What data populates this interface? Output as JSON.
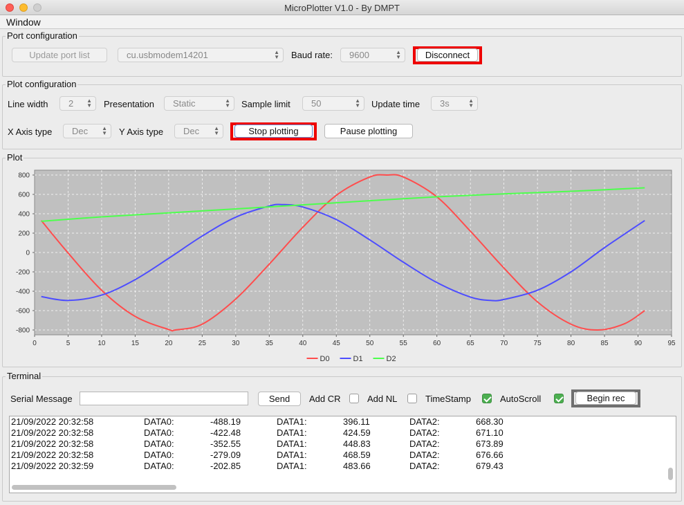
{
  "window": {
    "title": "MicroPlotter V1.0 - By DMPT",
    "menu": [
      "Window"
    ]
  },
  "port_config": {
    "title": "Port configuration",
    "update_port_list_label": "Update port list",
    "port_value": "cu.usbmodem14201",
    "baud_label": "Baud rate:",
    "baud_value": "9600",
    "disconnect_label": "Disconnect"
  },
  "plot_config": {
    "title": "Plot configuration",
    "line_width_label": "Line width",
    "line_width_value": "2",
    "presentation_label": "Presentation",
    "presentation_value": "Static",
    "sample_limit_label": "Sample limit",
    "sample_limit_value": "50",
    "update_time_label": "Update time",
    "update_time_value": "3s",
    "x_axis_label": "X Axis type",
    "x_axis_value": "Dec",
    "y_axis_label": "Y Axis type",
    "y_axis_value": "Dec",
    "stop_plotting_label": "Stop plotting",
    "pause_plotting_label": "Pause plotting"
  },
  "plot": {
    "title": "Plot"
  },
  "chart_data": {
    "type": "line",
    "xlim": [
      0,
      95
    ],
    "ylim": [
      -850,
      850
    ],
    "xticks": [
      0,
      5,
      10,
      15,
      20,
      25,
      30,
      35,
      40,
      45,
      50,
      55,
      60,
      65,
      70,
      75,
      80,
      85,
      90,
      95
    ],
    "yticks": [
      -800,
      -600,
      -400,
      -200,
      0,
      200,
      400,
      600,
      800
    ],
    "grid": true,
    "legend_position": "bottom-center",
    "plot_background": "#c0c0c0",
    "series": [
      {
        "name": "D0",
        "color": "#ff4d4d",
        "x": [
          1,
          5,
          10,
          15,
          20,
          21,
          25,
          30,
          35,
          40,
          45,
          50,
          52.5,
          55,
          60,
          65,
          70,
          75,
          80,
          84,
          88,
          91
        ],
        "y": [
          330,
          -5,
          -390,
          -660,
          -795,
          -800,
          -740,
          -480,
          -120,
          260,
          590,
          780,
          800,
          780,
          575,
          220,
          -160,
          -510,
          -740,
          -800,
          -735,
          -600
        ]
      },
      {
        "name": "D1",
        "color": "#4d4dff",
        "x": [
          1,
          5,
          10,
          15,
          20,
          25,
          30,
          35,
          37,
          40,
          45,
          50,
          55,
          60,
          65,
          68,
          70,
          75,
          80,
          85,
          91
        ],
        "y": [
          -455,
          -495,
          -440,
          -280,
          -60,
          170,
          365,
          480,
          495,
          470,
          340,
          130,
          -100,
          -310,
          -460,
          -495,
          -485,
          -390,
          -200,
          50,
          330
        ]
      },
      {
        "name": "D2",
        "color": "#4dff4d",
        "x": [
          1,
          10,
          20,
          30,
          40,
          50,
          60,
          70,
          80,
          91
        ],
        "y": [
          322,
          368,
          409,
          450,
          492,
          535,
          575,
          605,
          632,
          668
        ]
      }
    ]
  },
  "terminal": {
    "title": "Terminal",
    "serial_label": "Serial Message",
    "serial_value": "",
    "send_label": "Send",
    "add_cr_label": "Add CR",
    "add_cr_checked": false,
    "add_nl_label": "Add NL",
    "add_nl_checked": false,
    "timestamp_label": "TimeStamp",
    "timestamp_checked": true,
    "autoscroll_label": "AutoScroll",
    "autoscroll_checked": true,
    "begin_rec_label": "Begin rec",
    "log": [
      {
        "time": "21/09/2022 20:32:58",
        "k0": "DATA0:",
        "v0": "-488.19",
        "k1": "DATA1:",
        "v1": "396.11",
        "k2": "DATA2:",
        "v2": "668.30"
      },
      {
        "time": "21/09/2022 20:32:58",
        "k0": "DATA0:",
        "v0": "-422.48",
        "k1": "DATA1:",
        "v1": "424.59",
        "k2": "DATA2:",
        "v2": "671.10"
      },
      {
        "time": "21/09/2022 20:32:58",
        "k0": "DATA0:",
        "v0": "-352.55",
        "k1": "DATA1:",
        "v1": "448.83",
        "k2": "DATA2:",
        "v2": "673.89"
      },
      {
        "time": "21/09/2022 20:32:58",
        "k0": "DATA0:",
        "v0": "-279.09",
        "k1": "DATA1:",
        "v1": "468.59",
        "k2": "DATA2:",
        "v2": "676.66"
      },
      {
        "time": "21/09/2022 20:32:59",
        "k0": "DATA0:",
        "v0": "-202.85",
        "k1": "DATA1:",
        "v1": "483.66",
        "k2": "DATA2:",
        "v2": "679.43"
      }
    ]
  }
}
